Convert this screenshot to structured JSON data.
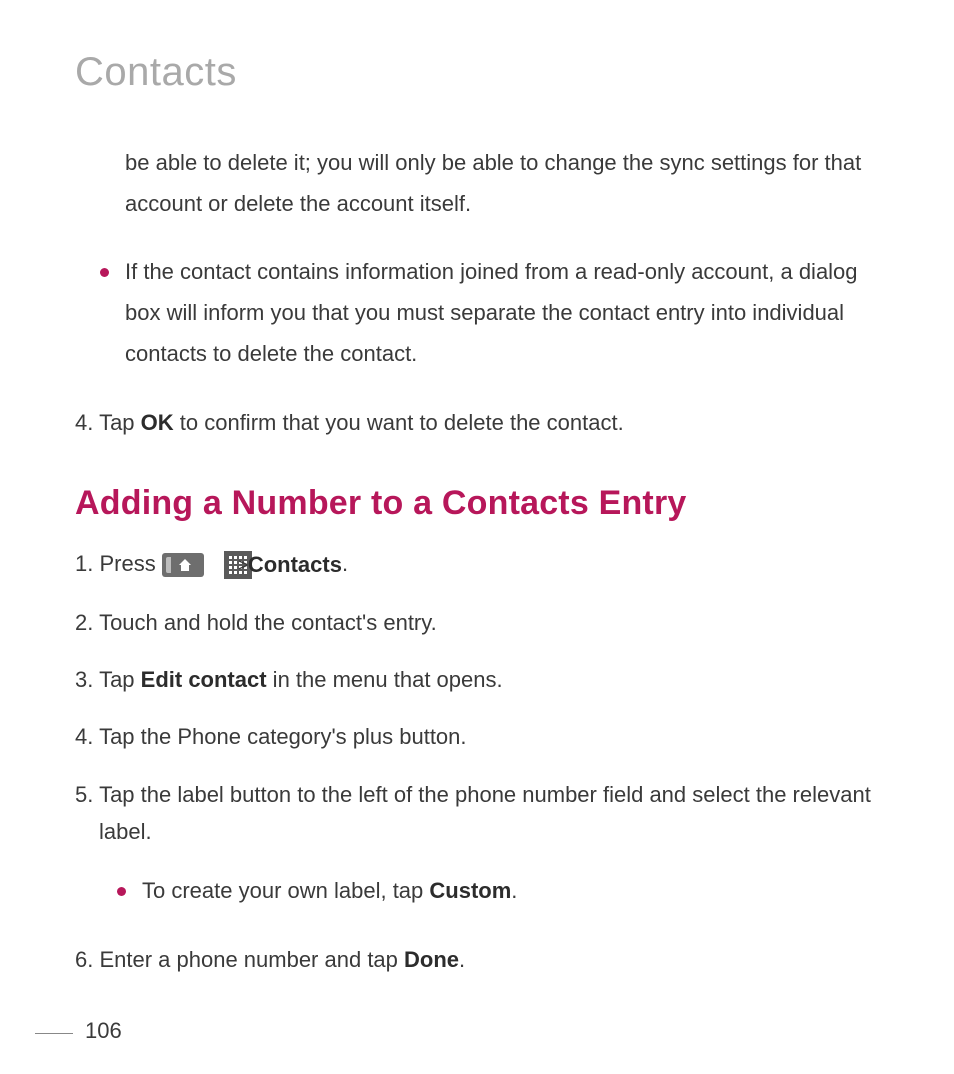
{
  "title": "Contacts",
  "continuation_paragraph": "be able to delete it; you will only be able to change the sync settings for that account or delete the account itself.",
  "bullet_readonly": "If the contact contains information joined from a read-only account, a dialog box will inform you that you must separate the contact entry into individual contacts to delete the contact.",
  "step4_prefix": "4. Tap ",
  "step4_bold": "OK",
  "step4_suffix": " to confirm that you want to delete the contact.",
  "section_heading": "Adding a Number to a Contacts Entry",
  "s1_prefix": "1. Press ",
  "s1_chev": ">",
  "s1_suffix_bold": "Contacts",
  "s1_period": ".",
  "s2": "2. Touch and hold the contact's entry.",
  "s3_prefix": "3. Tap ",
  "s3_bold": "Edit contact",
  "s3_suffix": " in the menu that opens.",
  "s4": "4. Tap the Phone category's plus button.",
  "s5": "5. Tap the label button to the left of the phone number field and select the relevant label.",
  "s5_bullet_prefix": "To create your own label, tap ",
  "s5_bullet_bold": "Custom",
  "s5_bullet_period": ".",
  "s6_prefix": "6. Enter a phone number and tap ",
  "s6_bold": "Done",
  "s6_period": ".",
  "page_number": "106"
}
